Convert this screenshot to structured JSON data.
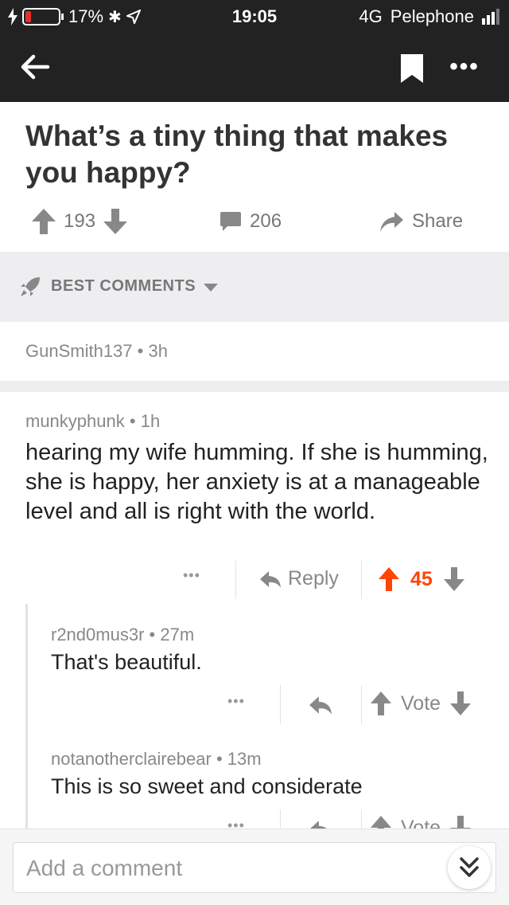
{
  "status_bar": {
    "battery": "17%",
    "battery_level": 0.17,
    "time": "19:05",
    "network": "4G",
    "carrier": "Pelephone"
  },
  "nav": {
    "back_icon": "back-arrow-icon",
    "bookmark_icon": "bookmark-icon",
    "more_icon": "more-icon"
  },
  "post": {
    "title": "What’s a tiny thing that makes you happy?",
    "score": "193",
    "comment_count": "206",
    "share_label": "Share"
  },
  "section": {
    "sort_label": "BEST COMMENTS"
  },
  "collapsed_comment": {
    "author": "GunSmith137",
    "age": "3h"
  },
  "comments": [
    {
      "author": "munkyphunk",
      "age": "1h",
      "body": "hearing my wife humming. If she is humming, she is happy, her anxiety is at a manageable level and all is right with the world.",
      "reply_label": "Reply",
      "score": "45",
      "more": "•••"
    }
  ],
  "replies": [
    {
      "author": "r2nd0mus3r",
      "age": "27m",
      "body": "That's beautiful.",
      "vote_label": "Vote",
      "more": "•••"
    },
    {
      "author": "notanotherclairebear",
      "age": "13m",
      "body": "This is so sweet and considerate",
      "vote_label": "Vote",
      "more": "•••"
    }
  ],
  "composer": {
    "placeholder": "Add a comment"
  },
  "colors": {
    "header": "#222222",
    "upvote_active": "#ff4500",
    "muted": "#888888",
    "band": "#eeeef0"
  }
}
